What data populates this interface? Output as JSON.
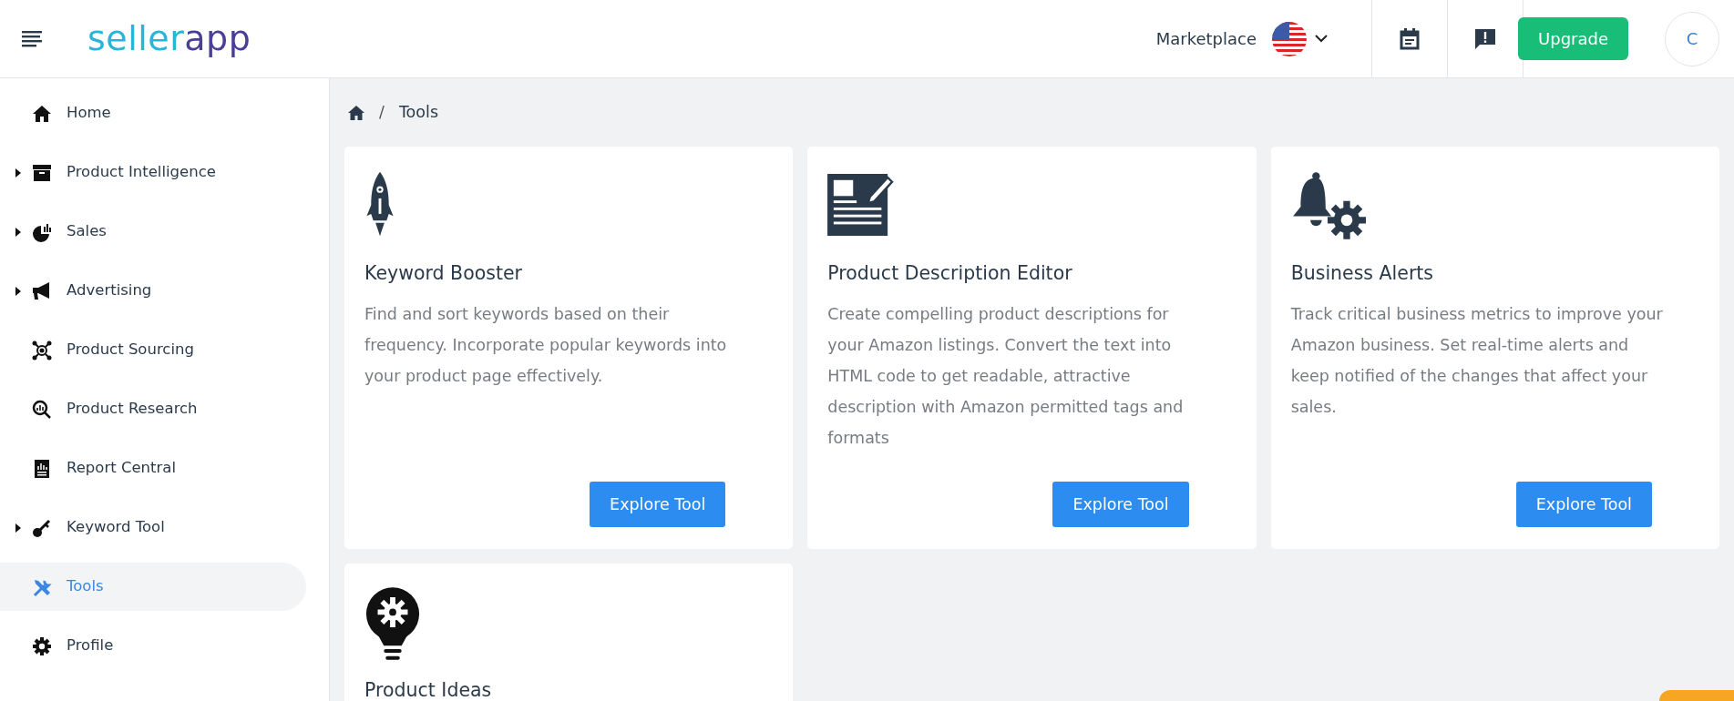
{
  "header": {
    "logo": {
      "part_1": "seller",
      "part_2": "app"
    },
    "marketplace_label": "Marketplace",
    "upgrade_button": "Upgrade",
    "avatar_initial": "C"
  },
  "sidebar": {
    "items": [
      {
        "label": "Home",
        "expandable": false,
        "selected": false
      },
      {
        "label": "Product Intelligence",
        "expandable": true,
        "selected": false
      },
      {
        "label": "Sales",
        "expandable": true,
        "selected": false
      },
      {
        "label": "Advertising",
        "expandable": true,
        "selected": false
      },
      {
        "label": "Product Sourcing",
        "expandable": false,
        "selected": false
      },
      {
        "label": "Product Research",
        "expandable": false,
        "selected": false
      },
      {
        "label": "Report Central",
        "expandable": false,
        "selected": false
      },
      {
        "label": "Keyword Tool",
        "expandable": true,
        "selected": false
      },
      {
        "label": "Tools",
        "expandable": false,
        "selected": true
      },
      {
        "label": "Profile",
        "expandable": false,
        "selected": false
      }
    ]
  },
  "breadcrumb": {
    "separator": "/",
    "items": [
      "Tools"
    ]
  },
  "tools": [
    {
      "title": "Keyword Booster",
      "description": "Find and sort keywords based on their frequency. Incorporate popular keywords into your product page effectively.",
      "button": "Explore Tool"
    },
    {
      "title": "Product Description Editor",
      "description": "Create compelling product descriptions for your Amazon listings. Convert the text into HTML code to get readable, attractive description with Amazon permitted tags and formats",
      "button": "Explore Tool"
    },
    {
      "title": "Business Alerts",
      "description": "Track critical business metrics to improve your Amazon business. Set real-time alerts and keep notified of the changes that affect your sales.",
      "button": "Explore Tool"
    },
    {
      "title": "Product Ideas"
    }
  ]
}
